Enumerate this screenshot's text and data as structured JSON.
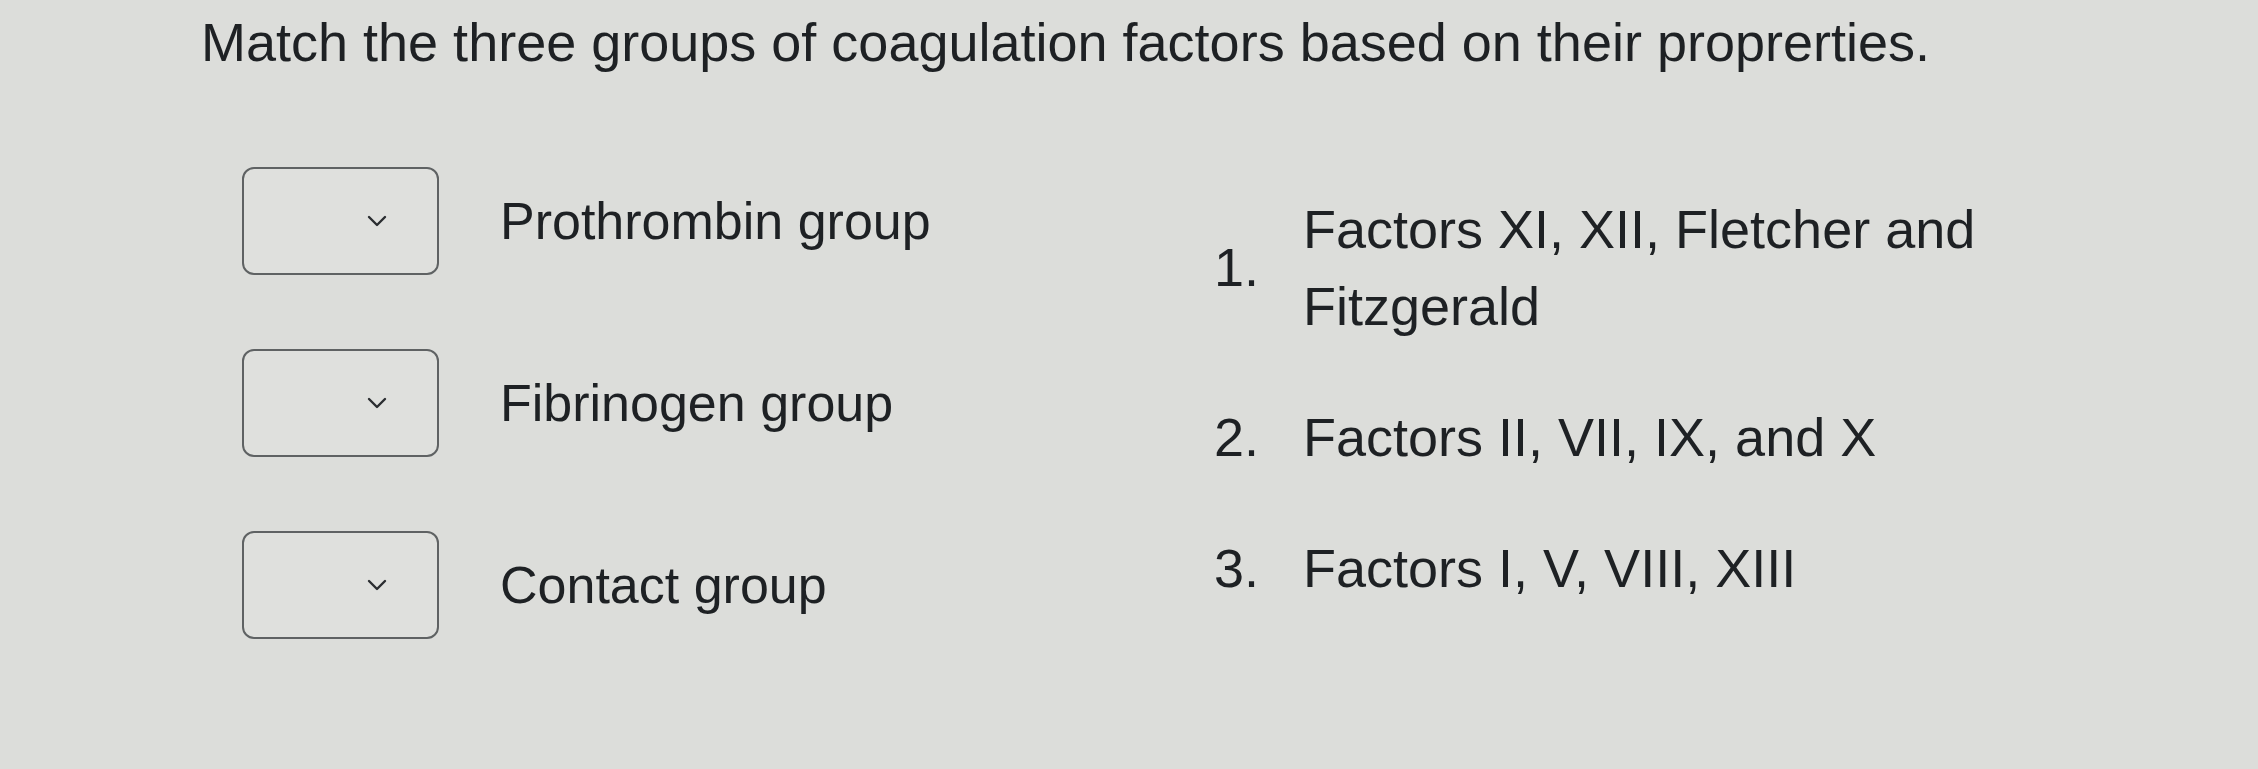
{
  "question": {
    "title": "Match the three groups of coagulation factors based on their proprerties."
  },
  "prompts": [
    {
      "label": "Prothrombin group"
    },
    {
      "label": "Fibrinogen group"
    },
    {
      "label": "Contact group"
    }
  ],
  "answers": [
    {
      "number": "1.",
      "text": "Factors XI, XII, Fletcher and Fitzgerald"
    },
    {
      "number": "2.",
      "text": "Factors II, VII, IX, and X"
    },
    {
      "number": "3.",
      "text": "Factors I, V, VIII, XIII"
    }
  ]
}
